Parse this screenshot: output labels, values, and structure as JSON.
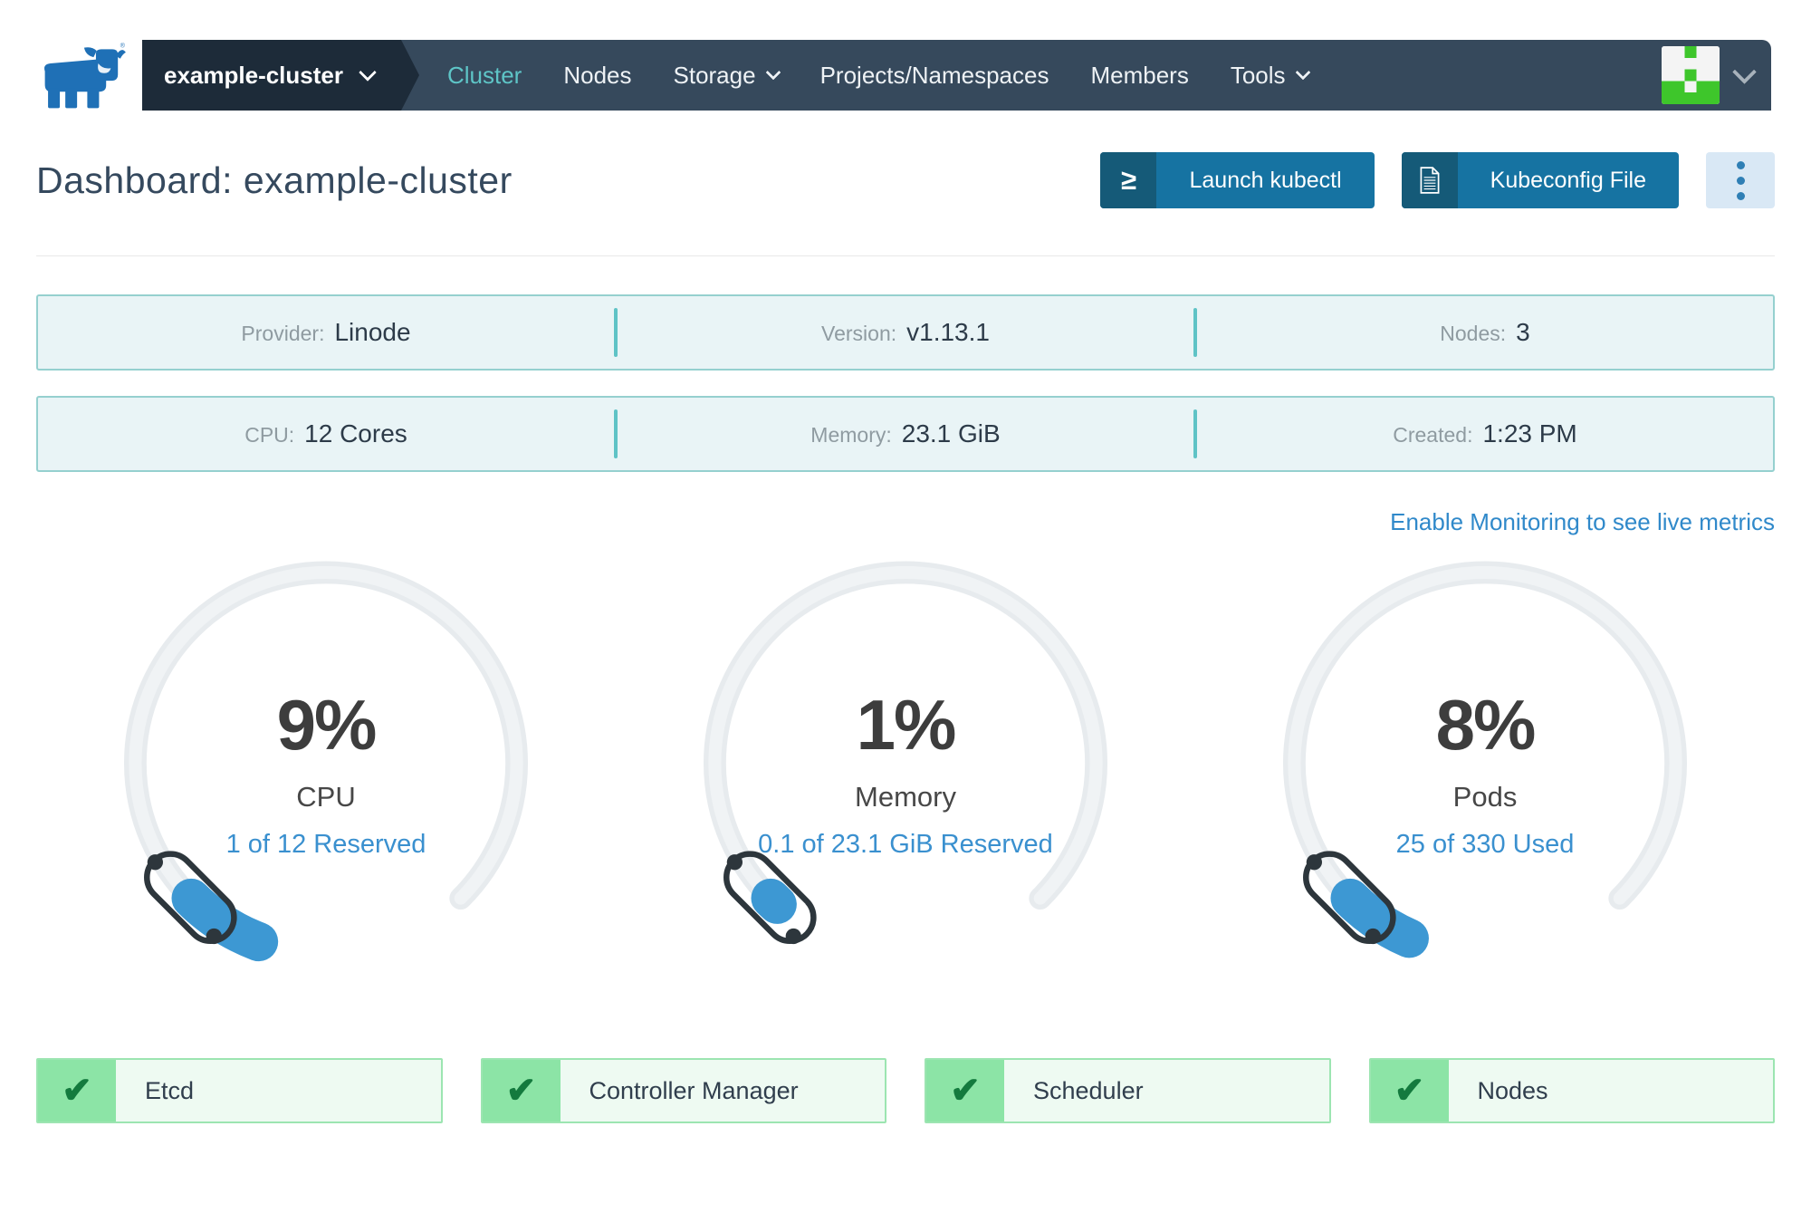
{
  "colors": {
    "accent_blue": "#3d98d3",
    "nav_bg": "#36495c",
    "nav_dark": "#1d2b39",
    "teal_active": "#5ec5c7",
    "button_blue": "#1673a2",
    "button_blue_dark": "#155a78",
    "kebab_bg": "#d9e8f5",
    "kebab_dot": "#2f7fb5",
    "info_bg": "#e9f4f6",
    "info_border": "#95d0cf",
    "info_separator": "#5fc3c6",
    "link_blue": "#3089ca",
    "gauge_track": "#e7ebee",
    "gauge_fill": "#3d98d3",
    "badge_green_block": "#8ce4a6",
    "badge_green_border": "#9ce5b1",
    "badge_green_bg": "#eefaf2",
    "check_green": "#147a3e",
    "identicon_green": "#3ec62b"
  },
  "nav": {
    "cluster_selector": {
      "label": "example-cluster"
    },
    "items": [
      {
        "label": "Cluster",
        "active": true,
        "has_chevron": false
      },
      {
        "label": "Nodes",
        "active": false,
        "has_chevron": false
      },
      {
        "label": "Storage",
        "active": false,
        "has_chevron": true
      },
      {
        "label": "Projects/Namespaces",
        "active": false,
        "has_chevron": false
      },
      {
        "label": "Members",
        "active": false,
        "has_chevron": false
      },
      {
        "label": "Tools",
        "active": false,
        "has_chevron": true
      }
    ]
  },
  "header": {
    "title": "Dashboard: example-cluster",
    "actions": {
      "launch_kubectl": "Launch kubectl",
      "kubeconfig_file": "Kubeconfig File",
      "terminal_icon_glyph": "≥"
    }
  },
  "info_rows": [
    [
      {
        "label": "Provider:",
        "value": "Linode"
      },
      {
        "label": "Version:",
        "value": "v1.13.1"
      },
      {
        "label": "Nodes:",
        "value": "3"
      }
    ],
    [
      {
        "label": "CPU:",
        "value": "12 Cores"
      },
      {
        "label": "Memory:",
        "value": "23.1 GiB"
      },
      {
        "label": "Created:",
        "value": "1:23 PM"
      }
    ]
  ],
  "monitoring_link": "Enable Monitoring to see live metrics",
  "gauges": [
    {
      "percent": 9,
      "percent_label": "9%",
      "label": "CPU",
      "detail": "1 of 12 Reserved"
    },
    {
      "percent": 1,
      "percent_label": "1%",
      "label": "Memory",
      "detail": "0.1 of 23.1 GiB Reserved"
    },
    {
      "percent": 8,
      "percent_label": "8%",
      "label": "Pods",
      "detail": "25 of 330 Used"
    }
  ],
  "chart_data": [
    {
      "type": "gauge",
      "title": "CPU",
      "value_percent": 9,
      "detail": "1 of 12 Reserved",
      "range": [
        0,
        100
      ],
      "arc_degrees": 270
    },
    {
      "type": "gauge",
      "title": "Memory",
      "value_percent": 1,
      "detail": "0.1 of 23.1 GiB Reserved",
      "range": [
        0,
        100
      ],
      "arc_degrees": 270
    },
    {
      "type": "gauge",
      "title": "Pods",
      "value_percent": 8,
      "detail": "25 of 330 Used",
      "range": [
        0,
        100
      ],
      "arc_degrees": 270
    }
  ],
  "components": [
    {
      "label": "Etcd",
      "status": "healthy",
      "check_glyph": "✔"
    },
    {
      "label": "Controller Manager",
      "status": "healthy",
      "check_glyph": "✔"
    },
    {
      "label": "Scheduler",
      "status": "healthy",
      "check_glyph": "✔"
    },
    {
      "label": "Nodes",
      "status": "healthy",
      "check_glyph": "✔"
    }
  ]
}
